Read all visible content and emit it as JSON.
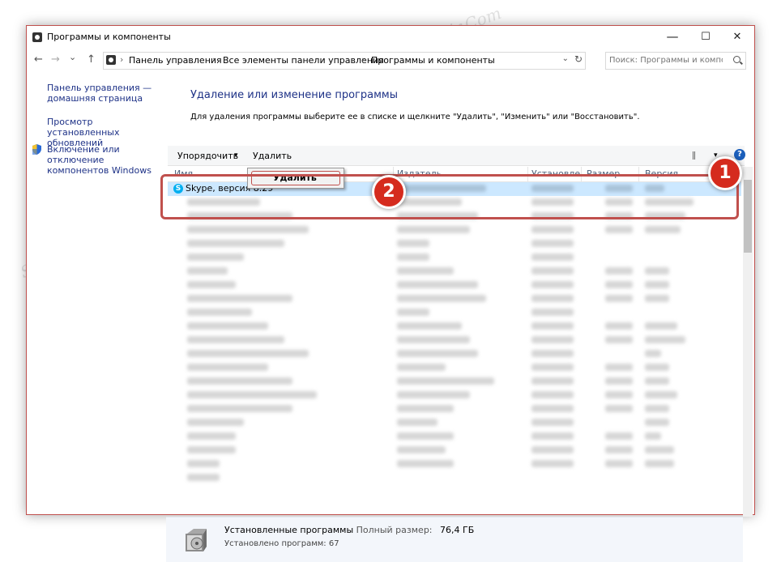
{
  "window": {
    "title": "Программы и компоненты",
    "minimize": "—",
    "maximize": "☐",
    "close": "✕"
  },
  "nav": {
    "back": "←",
    "forward": "→",
    "recent": "⌄",
    "up": "↑"
  },
  "address": {
    "crumbs": [
      "Панель управления",
      "Все элементы панели управления",
      "Программы и компоненты"
    ],
    "separator": "›",
    "dropdown": "⌄",
    "refresh": "↻"
  },
  "search": {
    "placeholder": "Поиск: Программы и компо..."
  },
  "sidebar": {
    "items": [
      {
        "label": "Панель управления — домашняя страница"
      },
      {
        "label": "Просмотр установленных обновлений"
      },
      {
        "label": "Включение или отключение компонентов Windows"
      }
    ]
  },
  "main": {
    "title": "Удаление или изменение программы",
    "description": "Для удаления программы выберите ее в списке и щелкните \"Удалить\", \"Изменить\" или \"Восстановить\"."
  },
  "toolbar": {
    "organize_label": "Упорядочить",
    "organize_arrow": "▾",
    "uninstall_label": "Удалить",
    "view_arrow": "▾",
    "help_label": "?"
  },
  "columns": [
    "Имя",
    "Издатель",
    "Установле",
    "Размер",
    "Версия"
  ],
  "selected_program": {
    "icon_letter": "S",
    "name": "Skype, версия 8.29"
  },
  "context_menu": {
    "uninstall_label": "Удалить"
  },
  "status": {
    "installed_label": "Установленные программы",
    "total_size_label": "Полный размер:",
    "total_size_value": "76,4 ГБ",
    "count_text": "Установлено программ: 67"
  },
  "annotations": {
    "step1": "1",
    "step2": "2"
  },
  "watermark": "Soringpcrepair.Com",
  "colors": {
    "accent": "#c0504d",
    "badge": "#d52b1e",
    "selection": "#cce8ff",
    "link": "#1e3287"
  }
}
